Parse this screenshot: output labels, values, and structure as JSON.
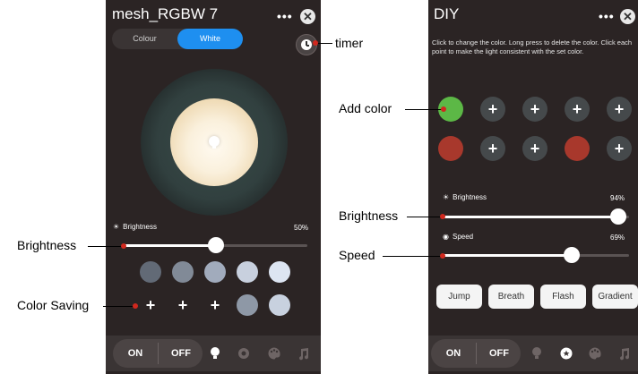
{
  "left": {
    "title": "mesh_RGBW 7",
    "menu_dots": "•••",
    "close": "✕",
    "tabs": [
      {
        "label": "Colour",
        "active": false
      },
      {
        "label": "White",
        "active": true
      }
    ],
    "brightness_label": "Brightness",
    "brightness_value": "50%",
    "brightness_level": 0.5,
    "saved_colors_row1": [
      "#626a76",
      "#818a97",
      "#a1abbc",
      "#c8d0de",
      "#dde5f2"
    ],
    "saved_colors_row2": [
      "+",
      "+",
      "+",
      "#8e98a6",
      "#c8d1df"
    ],
    "on_label": "ON",
    "off_label": "OFF"
  },
  "right": {
    "title": "DIY",
    "menu_dots": "•••",
    "close": "✕",
    "description": "Click to change the color. Long press to delete the color. Click each point to make the light consistent with the set color.",
    "row1": [
      "#5cb846",
      "+",
      "+",
      "+",
      "+"
    ],
    "row2": [
      "#a8382c",
      "+",
      "+",
      "#a8382c",
      "+"
    ],
    "brightness_label": "Brightness",
    "brightness_value": "94%",
    "brightness_level": 0.94,
    "speed_label": "Speed",
    "speed_value": "69%",
    "speed_level": 0.69,
    "modes": [
      "Jump",
      "Breath",
      "Flash",
      "Gradient"
    ],
    "on_label": "ON",
    "off_label": "OFF"
  },
  "annotations": {
    "timer": "timer",
    "brightness_left": "Brightness",
    "color_saving": "Color Saving",
    "add_color": "Add color",
    "brightness_right": "Brightness",
    "speed": "Speed"
  },
  "colors": {
    "phone_bg": "#2b2424",
    "accent": "#1e8ff0",
    "annot_dot": "#d0281e"
  }
}
